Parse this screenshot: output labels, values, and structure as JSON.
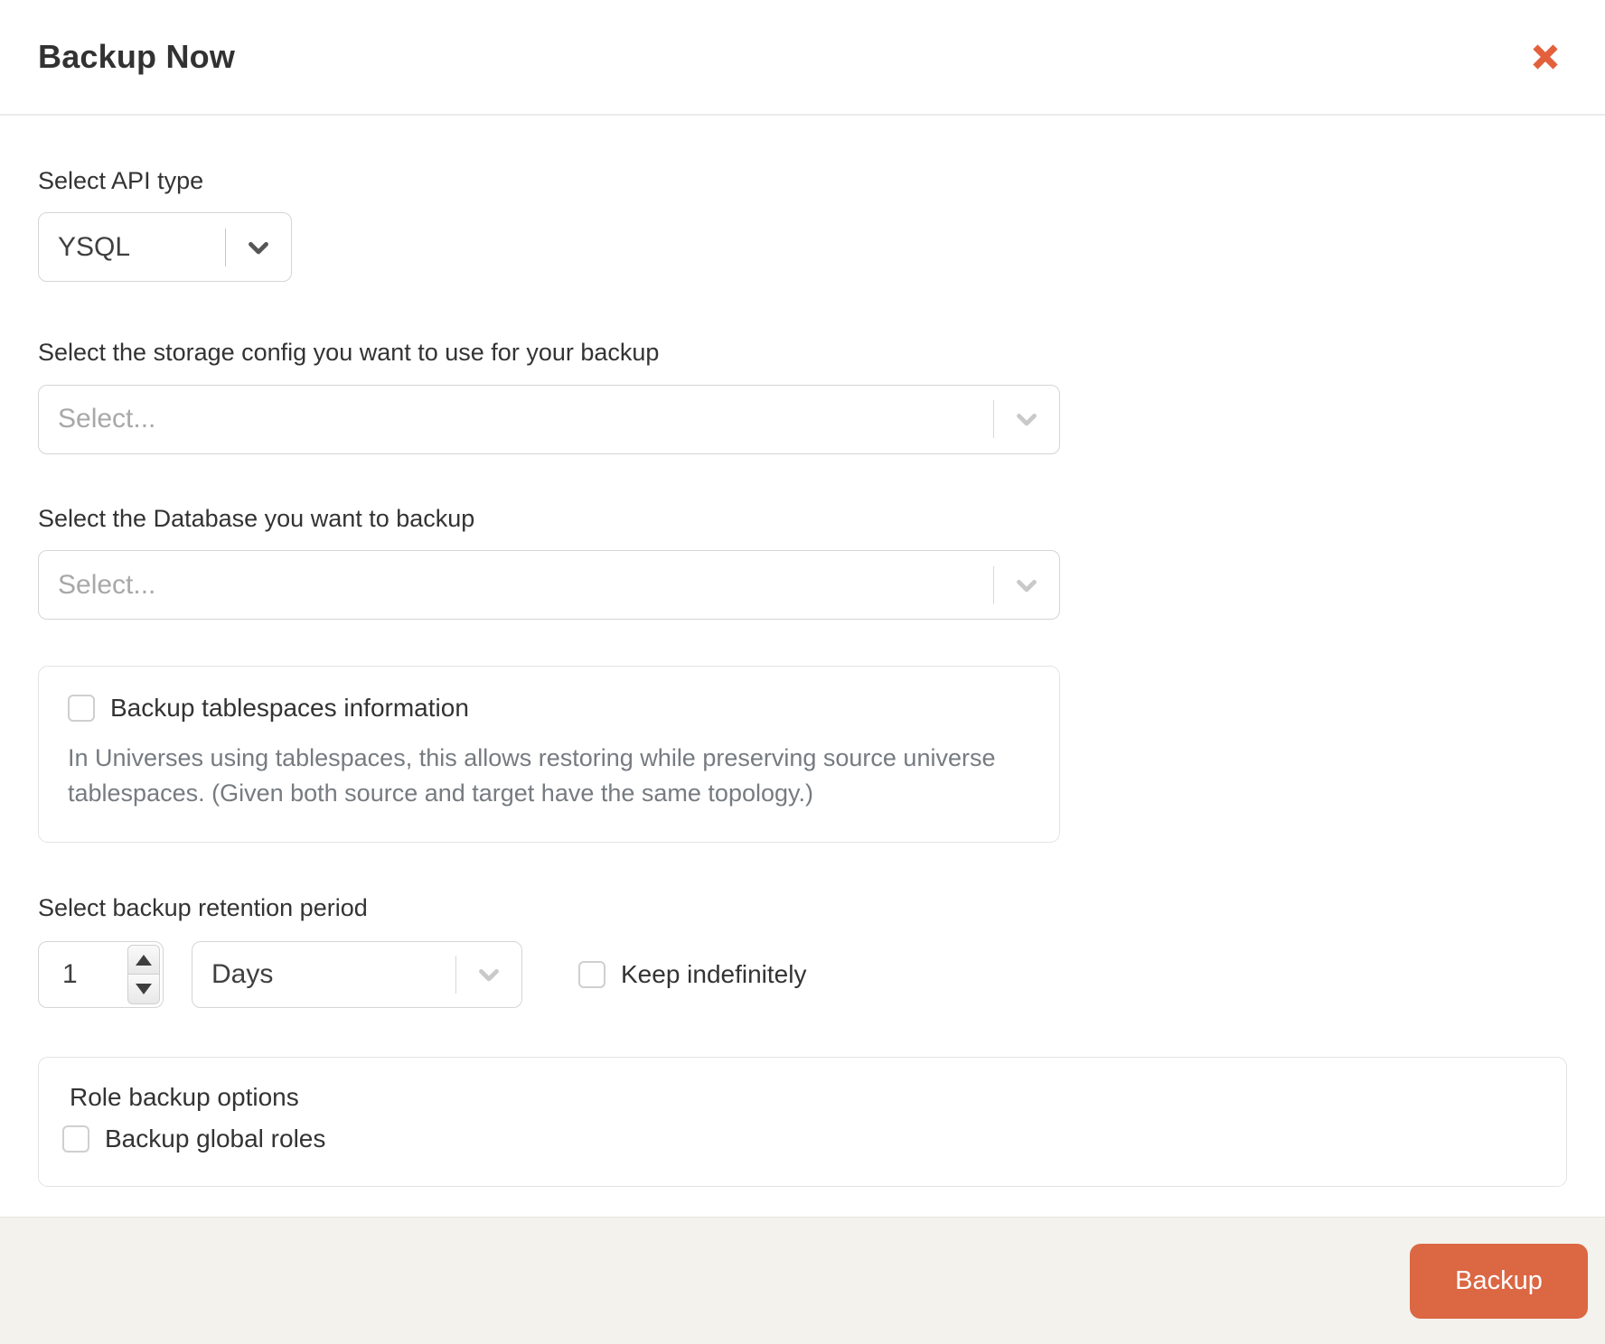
{
  "modal": {
    "title": "Backup Now"
  },
  "api_type": {
    "label": "Select API type",
    "value": "YSQL"
  },
  "storage_config": {
    "label": "Select the storage config you want to use for your backup",
    "placeholder": "Select..."
  },
  "database": {
    "label": "Select the Database you want to backup",
    "placeholder": "Select..."
  },
  "tablespaces": {
    "checkbox_label": "Backup tablespaces information",
    "checked": false,
    "description": "In Universes using tablespaces, this allows restoring while preserving source universe tablespaces. (Given both source and target have the same topology.)"
  },
  "retention": {
    "label": "Select backup retention period",
    "value": "1",
    "unit": "Days",
    "keep_indefinitely_label": "Keep indefinitely",
    "keep_indefinitely_checked": false
  },
  "role_options": {
    "title": "Role backup options",
    "checkbox_label": "Backup global roles",
    "checked": false
  },
  "footer": {
    "backup_button_label": "Backup"
  },
  "colors": {
    "accent_orange": "#dc6743",
    "close_icon_orange": "#e2613c",
    "placeholder_gray": "#a8a8a8",
    "description_gray": "#767b80"
  }
}
